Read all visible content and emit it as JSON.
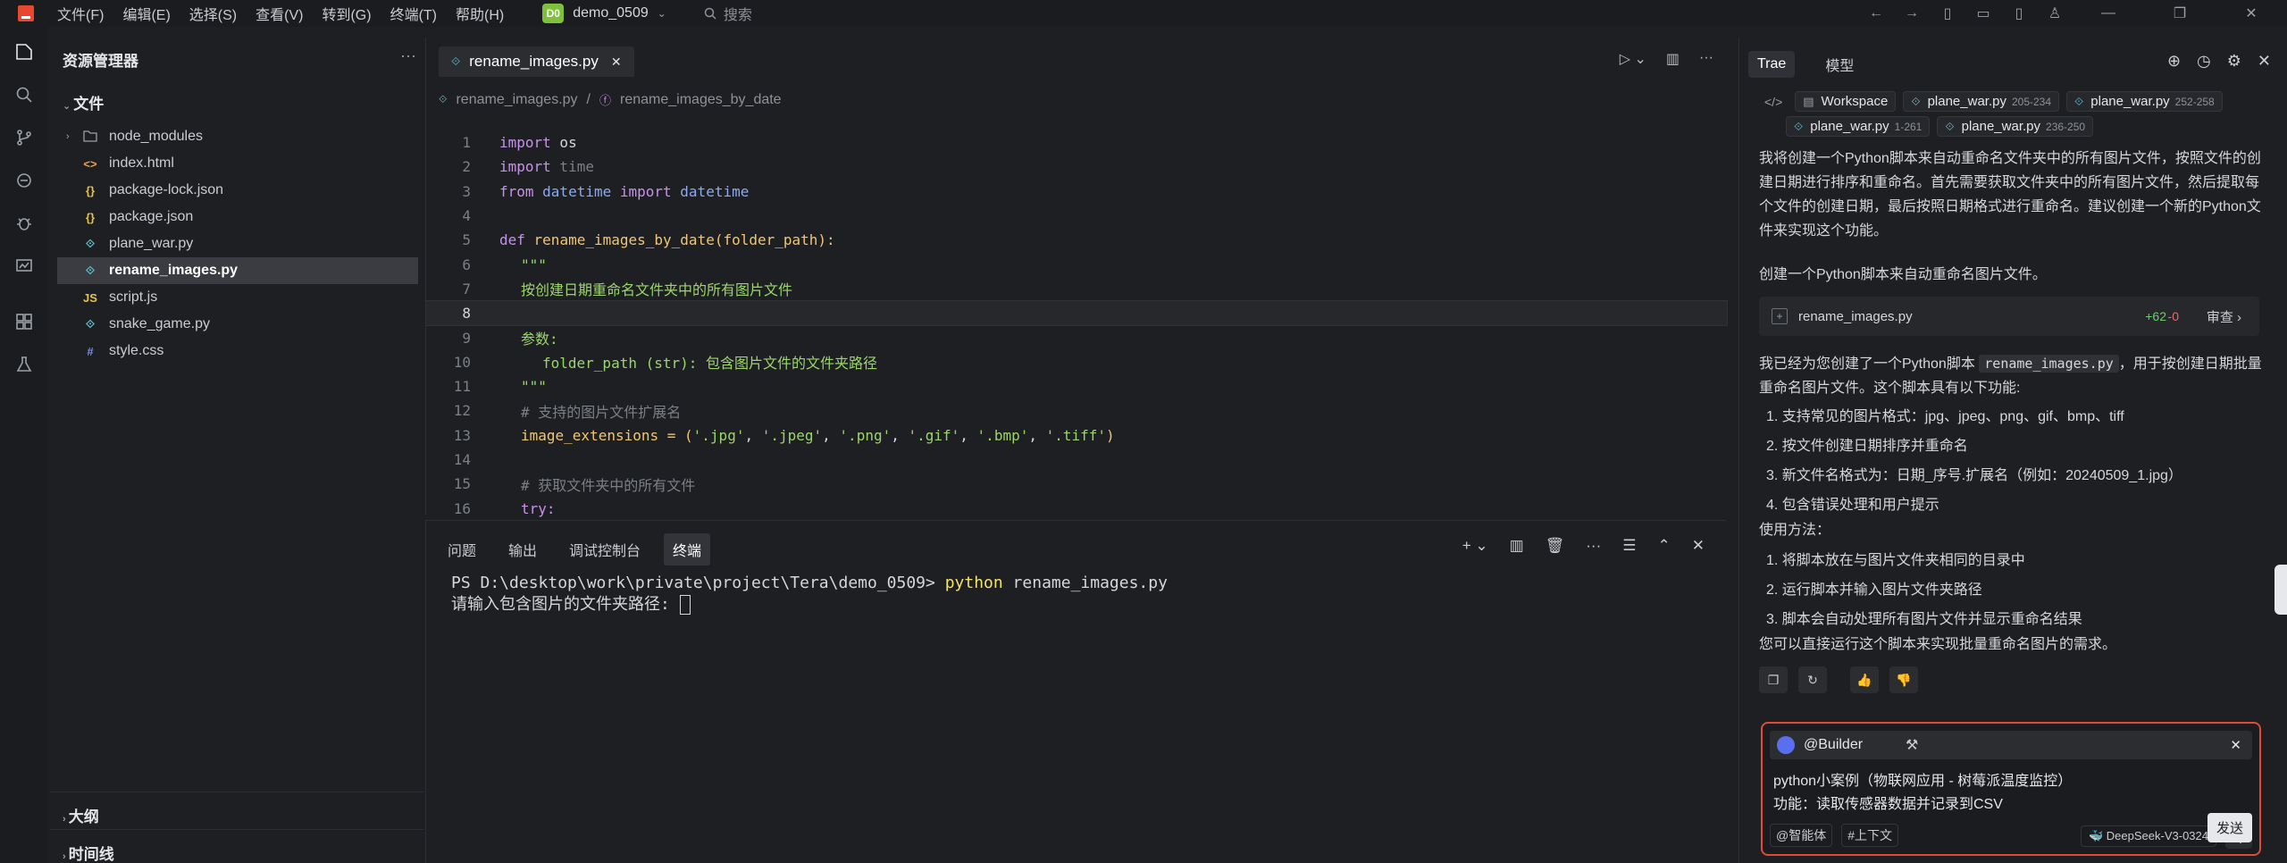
{
  "menu": [
    "文件(F)",
    "编辑(E)",
    "选择(S)",
    "查看(V)",
    "转到(G)",
    "终端(T)",
    "帮助(H)"
  ],
  "project": {
    "badge": "D0",
    "name": "demo_0509"
  },
  "search_placeholder": "搜索",
  "explorer": {
    "title": "资源管理器",
    "section": "文件",
    "items": [
      {
        "name": "node_modules",
        "icon": "folder-icon"
      },
      {
        "name": "index.html",
        "icon": "html-icon"
      },
      {
        "name": "package-lock.json",
        "icon": "json-icon"
      },
      {
        "name": "package.json",
        "icon": "json-icon"
      },
      {
        "name": "plane_war.py",
        "icon": "python-icon"
      },
      {
        "name": "rename_images.py",
        "icon": "python-icon"
      },
      {
        "name": "script.js",
        "icon": "js-icon"
      },
      {
        "name": "snake_game.py",
        "icon": "python-icon"
      },
      {
        "name": "style.css",
        "icon": "css-icon"
      }
    ],
    "outline": "大纲",
    "timeline": "时间线"
  },
  "editor": {
    "tab": "rename_images.py",
    "breadcrumb_file": "rename_images.py",
    "breadcrumb_sep": "/",
    "breadcrumb_symbol": "rename_images_by_date",
    "lines": [
      "1",
      "2",
      "3",
      "4",
      "5",
      "6",
      "7",
      "8",
      "9",
      "10",
      "11",
      "12",
      "13",
      "14",
      "15",
      "16"
    ]
  },
  "code": {
    "l1": [
      "import",
      " os"
    ],
    "l2": [
      "import",
      " time"
    ],
    "l3": [
      "from",
      " datetime ",
      "import",
      " datetime"
    ],
    "l5": [
      "def",
      " rename_images_by_date",
      "(folder_path):"
    ],
    "l6": "\"\"\"",
    "l7": "按创建日期重命名文件夹中的所有图片文件",
    "l9": "参数:",
    "l10": "folder_path (str): 包含图片文件的文件夹路径",
    "l11": "\"\"\"",
    "l12": "# 支持的图片文件扩展名",
    "l13a": "image_extensions = (",
    "l13s": [
      "'.jpg'",
      "'.jpeg'",
      "'.png'",
      "'.gif'",
      "'.bmp'",
      "'.tiff'"
    ],
    "l15": "# 获取文件夹中的所有文件",
    "l16": "try:"
  },
  "panel": {
    "tabs": [
      "问题",
      "输出",
      "调试控制台",
      "终端"
    ],
    "active_tab": "终端",
    "prompt_path": "PS D:\\desktop\\work\\private\\project\\Tera\\demo_0509> ",
    "command": "python",
    "command_args": " rename_images.py",
    "line2": "请输入包含图片的文件夹路径: "
  },
  "chat": {
    "tabs": [
      "Trae",
      "模型"
    ],
    "context": [
      {
        "label": "Workspace",
        "range": ""
      },
      {
        "label": "plane_war.py",
        "range": "205-234"
      },
      {
        "label": "plane_war.py",
        "range": "252-258"
      },
      {
        "label": "plane_war.py",
        "range": "1-261"
      },
      {
        "label": "plane_war.py",
        "range": "236-250"
      }
    ],
    "para1": "我将创建一个Python脚本来自动重命名文件夹中的所有图片文件，按照文件的创建日期进行排序和重命名。首先需要获取文件夹中的所有图片文件，然后提取每个文件的创建日期，最后按照日期格式进行重命名。建议创建一个新的Python文件来实现这个功能。",
    "para2": "创建一个Python脚本来自动重命名图片文件。",
    "file_card": {
      "name": "rename_images.py",
      "added": "+62",
      "removed": "-0",
      "review": "审查"
    },
    "para3_pre": "我已经为您创建了一个Python脚本 ",
    "para3_code": "rename_images.py",
    "para3_post": "，用于按创建日期批量重命名图片文件。这个脚本具有以下功能:",
    "features": [
      "1. 支持常见的图片格式：jpg、jpeg、png、gif、bmp、tiff",
      "2. 按文件创建日期排序并重命名",
      "3. 新文件名格式为：日期_序号.扩展名（例如：20240509_1.jpg）",
      "4. 包含错误处理和用户提示"
    ],
    "usage_title": "使用方法：",
    "usage": [
      "1. 将脚本放在与图片文件夹相同的目录中",
      "2. 运行脚本并输入图片文件夹路径",
      "3. 脚本会自动处理所有图片文件并显示重命名结果"
    ],
    "para4": "您可以直接运行这个脚本来实现批量重命名图片的需求。",
    "composer": {
      "agent": "@Builder",
      "line1": "python小案例（物联网应用 - 树莓派温度监控）",
      "line2": "功能：读取传感器数据并记录到CSV",
      "agent_btn": "@智能体",
      "context_btn": "#上下文",
      "model": "DeepSeek-V3-0324",
      "send_tooltip": "发送"
    }
  },
  "colors": {
    "accent": "#e04a3a",
    "python_icon": "#5bb5c7",
    "json_icon": "#e8c34a",
    "js_icon": "#e8c34a",
    "css_icon": "#7b89e8",
    "html_icon": "#e8a24a"
  }
}
